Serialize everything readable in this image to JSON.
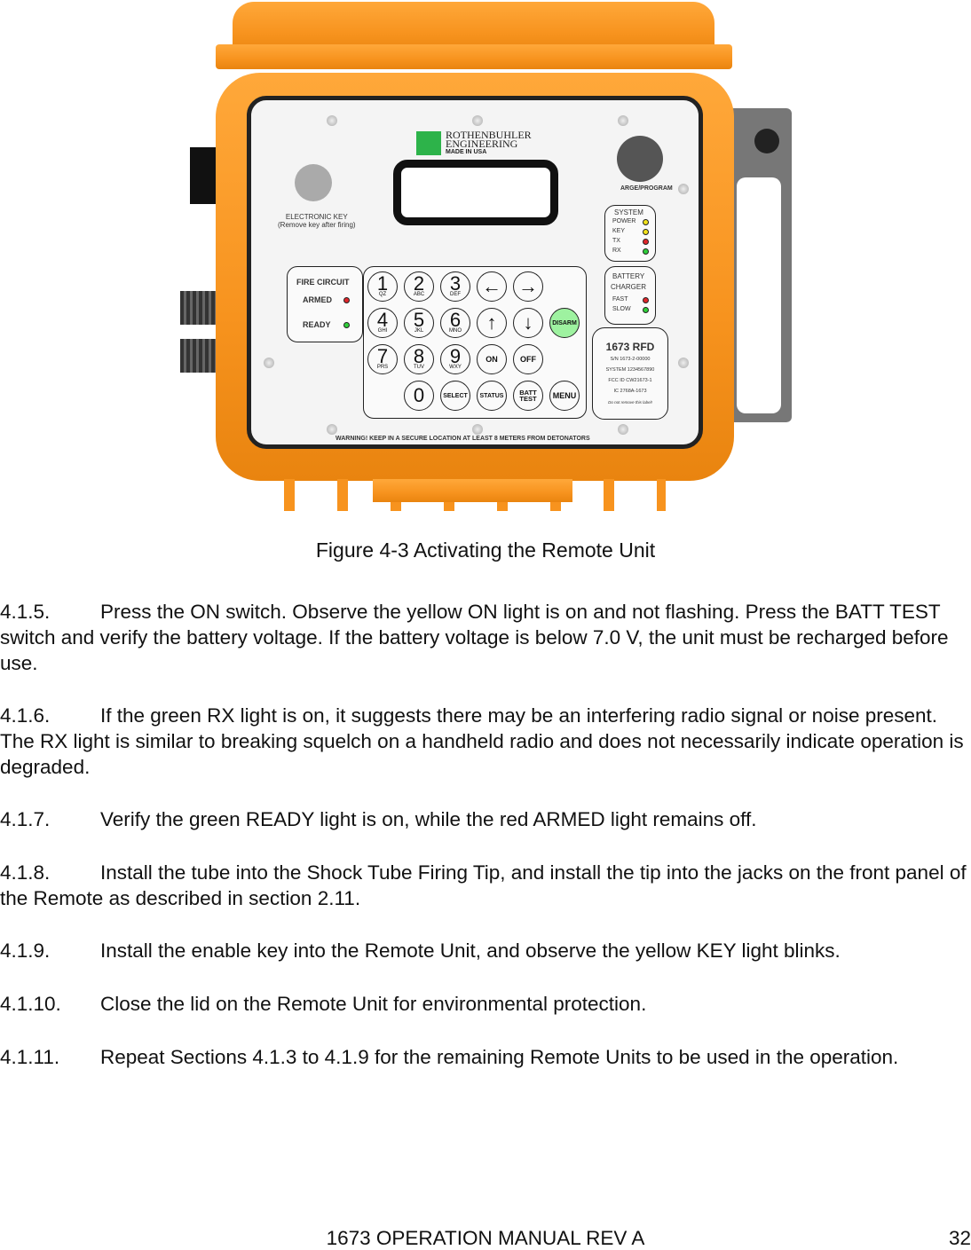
{
  "figure": {
    "brand": {
      "line1": "ROTHENBUHLER",
      "line2": "ENGINEERING",
      "line3": "MADE IN USA",
      "logo_color": "#2db34a"
    },
    "electronic_key": {
      "line1": "ELECTRONIC KEY",
      "line2": "(Remove key after firing)"
    },
    "charge_label": "ARGE/PROGRAM",
    "system": {
      "title": "SYSTEM",
      "leds": [
        {
          "label": "POWER",
          "color": "#f2e21c"
        },
        {
          "label": "KEY",
          "color": "#f2e21c"
        },
        {
          "label": "TX",
          "color": "#e0262a"
        },
        {
          "label": "RX",
          "color": "#2fcf3a"
        }
      ]
    },
    "fire_circuit": {
      "title": "FIRE CIRCUIT",
      "armed": "ARMED",
      "ready": "READY",
      "armed_color": "#e0262a",
      "ready_color": "#2fcf3a"
    },
    "battery": {
      "title1": "BATTERY",
      "title2": "CHARGER",
      "fast": "FAST",
      "slow": "SLOW"
    },
    "keys": [
      {
        "n": "1",
        "s": "QZ"
      },
      {
        "n": "2",
        "s": "ABC"
      },
      {
        "n": "3",
        "s": "DEF"
      },
      {
        "label": "←"
      },
      {
        "label": "→"
      },
      {
        "label": ""
      },
      {
        "n": "4",
        "s": "GHI"
      },
      {
        "n": "5",
        "s": "JKL"
      },
      {
        "n": "6",
        "s": "MNO"
      },
      {
        "label": "↑"
      },
      {
        "label": "↓"
      },
      {
        "label": "DISARM"
      },
      {
        "n": "7",
        "s": "PRS"
      },
      {
        "n": "8",
        "s": "TUV"
      },
      {
        "n": "9",
        "s": "WXY"
      },
      {
        "label": "ON"
      },
      {
        "label": "OFF"
      },
      {
        "label": ""
      },
      {
        "label": ""
      },
      {
        "n": "0",
        "s": ""
      },
      {
        "label": "SELECT"
      },
      {
        "label": "STATUS"
      },
      {
        "label": "BATT TEST"
      },
      {
        "label": "MENU"
      }
    ],
    "id_label": {
      "model": "1673 RFD",
      "sn": "S/N 1673-2-00000",
      "system": "SYSTEM 1234567890",
      "fcc": "FCC ID CW21673-1",
      "ic": "IC 2768A-1673",
      "note": "Do not remove this label!"
    },
    "warning": "WARNING! KEEP IN A SECURE LOCATION AT LEAST 8 METERS FROM DETONATORS",
    "case_color": "#f7931e"
  },
  "caption": "Figure 4-3 Activating the Remote Unit",
  "paragraphs": [
    {
      "num": "4.1.5.",
      "text": "Press the ON switch.  Observe the yellow ON light is on and not flashing.  Press the BATT TEST switch and verify the battery voltage. If the battery voltage is below 7.0 V, the unit must be recharged before use."
    },
    {
      "num": "4.1.6.",
      "text": "If the green RX light is on, it suggests there may be an interfering radio signal or noise present.  The RX light is similar to breaking squelch on a handheld radio and does not necessarily indicate operation is degraded."
    },
    {
      "num": "4.1.7.",
      "text": "Verify the green READY light is on, while the red ARMED light remains off."
    },
    {
      "num": "4.1.8.",
      "text": "Install the tube into the Shock Tube Firing Tip, and install the tip into the jacks on the front panel of the Remote as described in section 2.11."
    },
    {
      "num": "4.1.9.",
      "text": "Install the enable key into the Remote Unit, and observe the yellow KEY light blinks."
    },
    {
      "num": "4.1.10.",
      "text": "Close the lid on the Remote Unit for environmental protection."
    },
    {
      "num": "4.1.11.",
      "text": "Repeat Sections 4.1.3 to 4.1.9 for the remaining Remote Units to be used in the operation."
    }
  ],
  "footer": {
    "title": "1673 OPERATION MANUAL REV A",
    "page": "32"
  }
}
